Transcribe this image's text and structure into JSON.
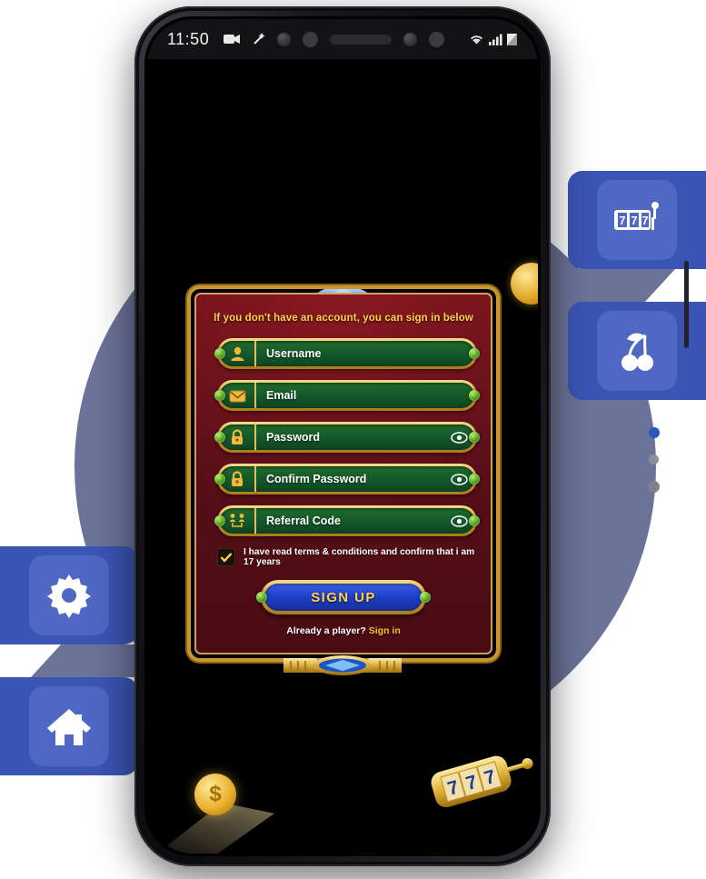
{
  "device": {
    "status_bar": {
      "time": "11:50",
      "left_icons": [
        "video-camera-icon",
        "magic-wand-icon",
        "front-camera-icon"
      ],
      "center_icons": [
        "speaker-grille",
        "sensor-dot",
        "camera-dot"
      ],
      "right_icons": [
        "wifi-icon",
        "signal-bars-icon",
        "battery-icon"
      ]
    }
  },
  "app": {
    "panel": {
      "title": "If you don't have an account, you can sign in below",
      "fields": [
        {
          "icon": "user-icon",
          "label": "Username",
          "has_eye": false
        },
        {
          "icon": "envelope-icon",
          "label": "Email",
          "has_eye": false
        },
        {
          "icon": "lock-icon",
          "label": "Password",
          "has_eye": true
        },
        {
          "icon": "lock-icon",
          "label": "Confirm Password",
          "has_eye": true
        },
        {
          "icon": "referral-icon",
          "label": "Referral Code",
          "has_eye": true
        }
      ],
      "terms": {
        "checked": true,
        "label": "I have read terms & conditions and confirm that i am 17 years"
      },
      "signup_button": "SIGN UP",
      "footer_prefix": "Already a player? ",
      "footer_link": "Sign in"
    },
    "decorations": {
      "top_gem": "blue-gem-cluster",
      "bottom_ornament": "gold-gem-ornament",
      "diamond": "white-diamond",
      "coin_right": "gold-coin",
      "coin_bottom": "gold-coin",
      "slot_machine": "777-slot-machine",
      "slot_reels": [
        "7",
        "7",
        "7"
      ]
    }
  },
  "side_badges": [
    {
      "name": "slot-777-badge",
      "icon": "slot-777-icon",
      "side": "right"
    },
    {
      "name": "cherry-badge",
      "icon": "cherry-icon",
      "side": "right"
    },
    {
      "name": "settings-badge",
      "icon": "gear-icon",
      "side": "left"
    },
    {
      "name": "home-badge",
      "icon": "home-icon",
      "side": "left"
    }
  ],
  "pagination": {
    "dots": 3,
    "active_index": 0
  },
  "colors": {
    "badge_panel": "#3b55b4",
    "badge_inner": "#4f68c4",
    "bg_circle": "#6b7398",
    "panel_red": "#5a0f18",
    "gold": "#d4a43a",
    "field_green": "#14572a",
    "accent_yellow": "#ffd24a",
    "button_blue": "#1d3fc9",
    "link_orange": "#ffc227"
  }
}
